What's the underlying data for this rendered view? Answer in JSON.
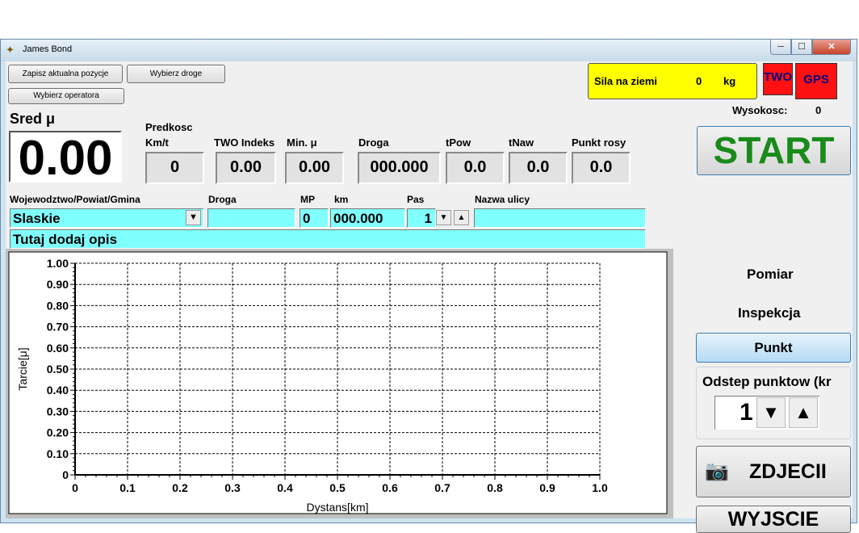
{
  "window": {
    "title": "James Bond",
    "min": "─",
    "max": "☐",
    "close": "✕"
  },
  "toolbar": {
    "save_position": "Zapisz aktualna pozycje",
    "choose_road": "Wybierz droge",
    "choose_operator": "Wybierz operatora"
  },
  "force": {
    "label": "Sila na ziemi",
    "value": "0",
    "unit": "kg"
  },
  "status": {
    "two": "TWO",
    "gps": "GPS"
  },
  "altitude": {
    "label": "Wysokosc:",
    "value": "0"
  },
  "sred": {
    "label": "Sred μ",
    "value": "0.00"
  },
  "readouts": [
    {
      "label": "Predkosc\nKm/t",
      "value": "0"
    },
    {
      "label": "TWO Indeks",
      "value": "0.00"
    },
    {
      "label": "Min. μ",
      "value": "0.00"
    },
    {
      "label": "Droga",
      "value": "000.000"
    },
    {
      "label": "tPow",
      "value": "0.0"
    },
    {
      "label": "tNaw",
      "value": "0.0"
    },
    {
      "label": "Punkt rosy",
      "value": "0.0"
    }
  ],
  "location": {
    "region_label": "Wojewodztwo/Powiat/Gmina",
    "region_value": "Slaskie",
    "road_label": "Droga",
    "road_value": "",
    "mp_label": "MP",
    "mp_value": "0",
    "km_label": "km",
    "km_value": "000.000",
    "lane_label": "Pas",
    "lane_value": "1",
    "street_label": "Nazwa ulicy",
    "street_value": "",
    "description": "Tutaj dodaj opis"
  },
  "right": {
    "start": "START",
    "pomiar": "Pomiar",
    "inspekcja": "Inspekcja",
    "punkt": "Punkt",
    "spacing_label": "Odstep punktow (kr",
    "spacing_value": "1",
    "photo": "ZDJECII",
    "exit": "WYJSCIE"
  },
  "colors": {
    "cyan": "#80ffff",
    "force_bg": "#ffff00",
    "status_red": "#ff1111",
    "start_green": "#1a8a1a",
    "status_text": "#000080"
  },
  "chart_data": {
    "type": "line",
    "title": "",
    "xlabel": "Dystans[km]",
    "ylabel": "Tarcie[μ]",
    "xlim": [
      0,
      1.0
    ],
    "ylim": [
      0,
      1.0
    ],
    "x_ticks": [
      "0",
      "0.1",
      "0.2",
      "0.3",
      "0.4",
      "0.5",
      "0.6",
      "0.7",
      "0.8",
      "0.9",
      "1.0"
    ],
    "y_ticks": [
      "0",
      "0.10",
      "0.20",
      "0.30",
      "0.40",
      "0.50",
      "0.60",
      "0.70",
      "0.80",
      "0.90",
      "1.00"
    ],
    "grid": true,
    "series": []
  }
}
